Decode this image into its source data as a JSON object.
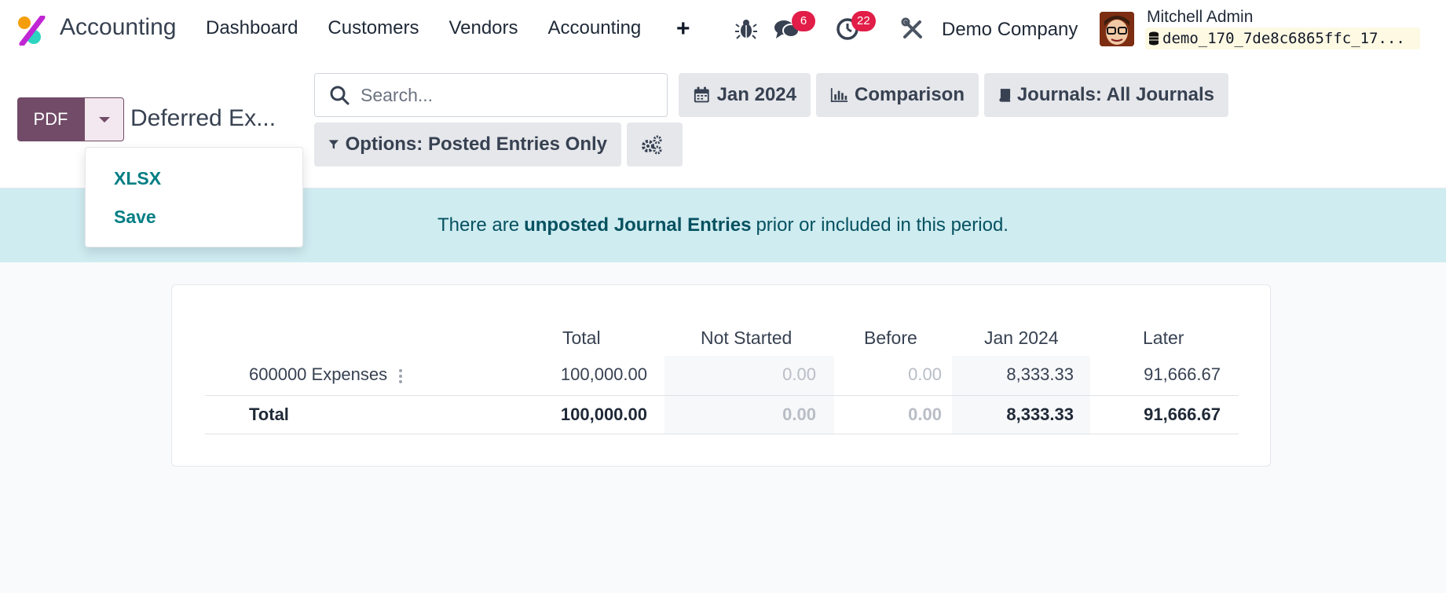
{
  "navbar": {
    "app_name": "Accounting",
    "menu": [
      "Dashboard",
      "Customers",
      "Vendors",
      "Accounting"
    ],
    "messages_count": "6",
    "activities_count": "22",
    "company": "Demo Company",
    "user_name": "Mitchell Admin",
    "database": "demo_170_7de8c6865ffc_17..."
  },
  "toolbar": {
    "pdf_label": "PDF",
    "report_title": "Deferred Ex...",
    "search_placeholder": "Search...",
    "date_filter": "Jan 2024",
    "comparison": "Comparison",
    "journals": "Journals: All Journals",
    "options": "Options: Posted Entries Only"
  },
  "export_menu": {
    "items": [
      "XLSX",
      "Save"
    ]
  },
  "alert": {
    "prefix": "There are",
    "link": "unposted Journal Entries",
    "suffix": "prior or included in this period."
  },
  "report": {
    "columns": [
      "Total",
      "Not Started",
      "Before",
      "Jan 2024",
      "Later"
    ],
    "rows": [
      {
        "label": "600000 Expenses",
        "values": [
          "100,000.00",
          "0.00",
          "0.00",
          "8,333.33",
          "91,666.67"
        ]
      }
    ],
    "total": {
      "label": "Total",
      "values": [
        "100,000.00",
        "0.00",
        "0.00",
        "8,333.33",
        "91,666.67"
      ]
    }
  },
  "colors": {
    "brand": "#714b67",
    "link": "#017e84",
    "badge": "#e11d48",
    "alert_bg": "#cfecf1"
  }
}
